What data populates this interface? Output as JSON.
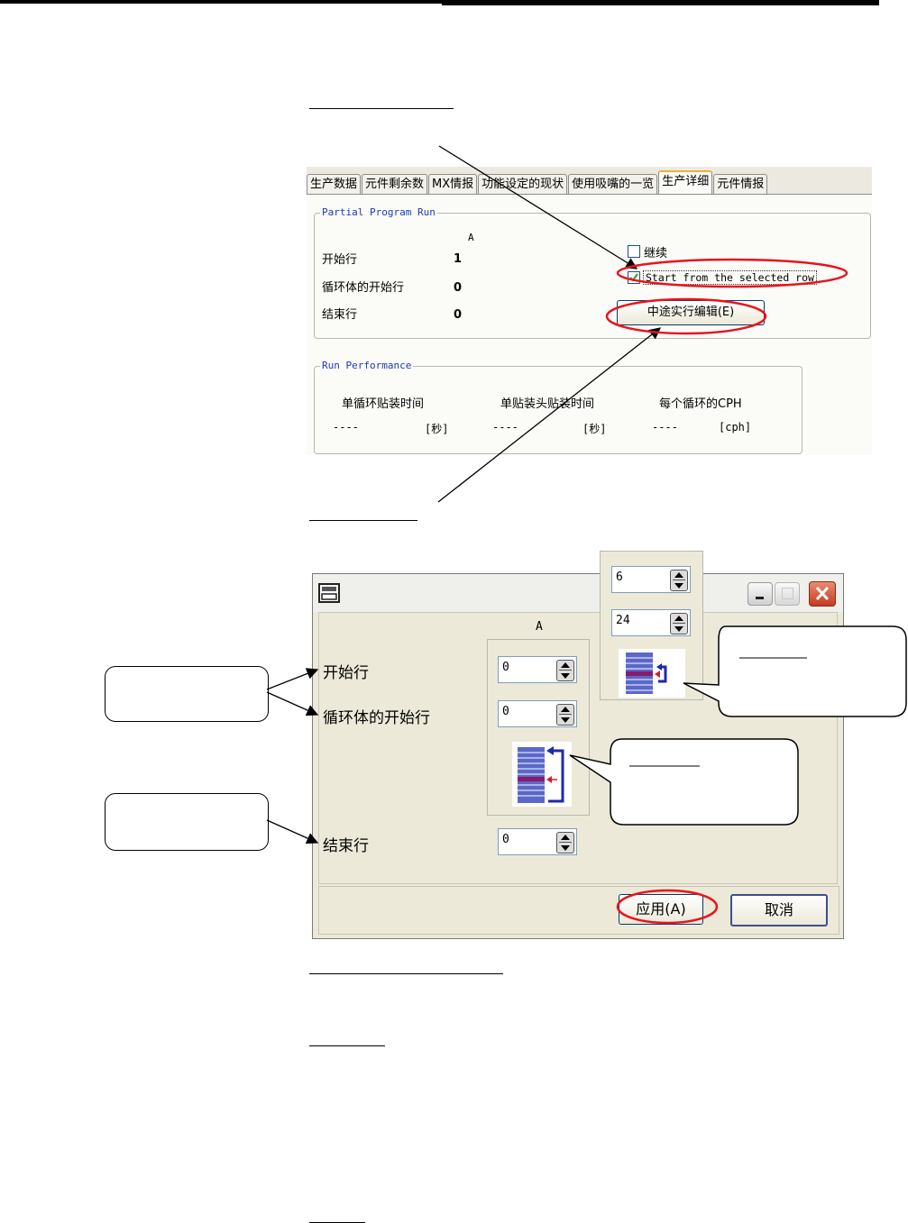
{
  "tabs": [
    "生产数据",
    "元件剩余数",
    "MX情报",
    "功能设定的现状",
    "使用吸嘴的一览",
    "生产详细",
    "元件情报"
  ],
  "active_tab": 5,
  "partial_run": {
    "legend": "Partial Program Run",
    "column": "A",
    "start_row_label": "开始行",
    "start_row_value": "1",
    "loop_start_label": "循环体的开始行",
    "loop_start_value": "0",
    "end_row_label": "结束行",
    "end_row_value": "0",
    "continue_label": "继续",
    "start_selected_label": "Start from the selected row",
    "edit_button": "中途实行编辑(E)"
  },
  "run_perf": {
    "legend": "Run Performance",
    "headers": [
      "单循环贴装时间",
      "单贴装头贴装时间",
      "每个循环的CPH"
    ],
    "values": [
      "----",
      "----",
      "----"
    ],
    "units": [
      "[秒]",
      "[秒]",
      "[cph]"
    ]
  },
  "dialog": {
    "column": "A",
    "start_row_label": "开始行",
    "start_row_value": "0",
    "loop_start_label": "循环体的开始行",
    "loop_start_value": "0",
    "end_row_label": "结束行",
    "end_row_value": "0",
    "apply_button": "应用(A)",
    "cancel_button": "取消"
  },
  "popup": {
    "value1": "6",
    "value2": "24"
  },
  "colors": {
    "highlight_red": "#e8141c",
    "legend_blue": "#1b3ab6",
    "close_red": "#d9442a",
    "stripe_blue": "#5b68c9",
    "marker_purple": "#8b1a6b"
  }
}
